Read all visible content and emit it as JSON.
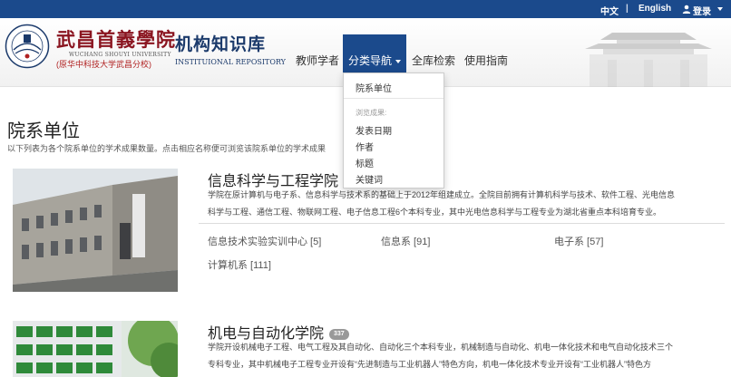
{
  "topbar": {
    "lang_zh": "中文",
    "separator": "|",
    "lang_en": "English",
    "login": "登录"
  },
  "header": {
    "school_name": "武昌首義學院",
    "school_name_en": "WUCHANG SHOUYI UNIVERSITY",
    "school_subtitle": "(原华中科技大学武昌分校)",
    "repo_name": "机构知识库",
    "repo_name_en": "INSTITUIONAL REPOSITORY",
    "emblem_text": "武昌首义学院"
  },
  "nav": {
    "items": [
      {
        "label": "教师学者"
      },
      {
        "label": "分类导航"
      },
      {
        "label": "全库检索"
      },
      {
        "label": "使用指南"
      }
    ]
  },
  "dropdown": {
    "item_dept": "院系单位",
    "header_browse": "浏览成果:",
    "item_date": "发表日期",
    "item_author": "作者",
    "item_title": "标题",
    "item_keyword": "关键词"
  },
  "main": {
    "title": "院系单位",
    "intro": "以下列表为各个院系单位的学术成果数量。点击相应名称便可浏览该院系单位的学术成果"
  },
  "departments": [
    {
      "name": "信息科学与工程学院",
      "count": "",
      "description_line1": "学院在原计算机与电子系、信息科学与技术系的基础上于2012年组建成立。全院目前拥有计算机科学与技术、软件工程、光电信息",
      "description_line2": "科学与工程、通信工程、物联网工程、电子信息工程6个本科专业，其中光电信息科学与工程专业为湖北省重点本科培育专业。",
      "sub_units": [
        {
          "label": "信息技术实验实训中心 [5]"
        },
        {
          "label": "信息系 [91]"
        },
        {
          "label": "电子系 [57]"
        },
        {
          "label": "计算机系 [111]"
        }
      ]
    },
    {
      "name": "机电与自动化学院",
      "count": "337",
      "description_line1": "学院开设机械电子工程、电气工程及其自动化、自动化三个本科专业，机械制造与自动化、机电一体化技术和电气自动化技术三个",
      "description_line2": "专科专业，其中机械电子工程专业开设有“先进制造与工业机器人”特色方向，机电一体化技术专业开设有“工业机器人”特色方"
    }
  ],
  "colors": {
    "topbar": "#1b4a8c",
    "nav_active": "#1b4a8c",
    "school_red": "#8a1520",
    "badge": "#999999"
  }
}
